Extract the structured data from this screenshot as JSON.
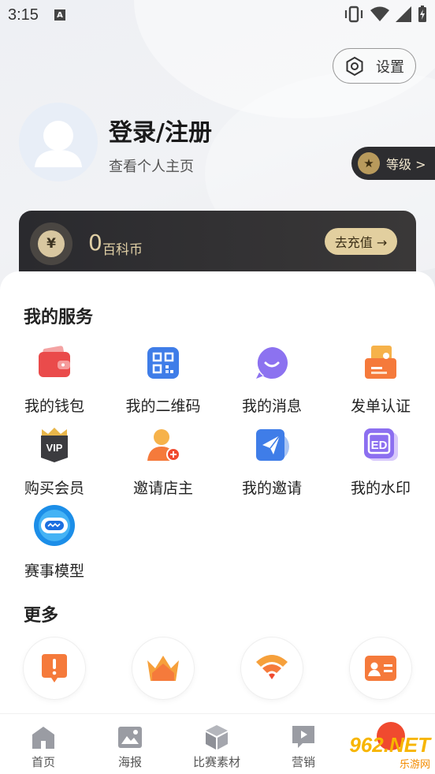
{
  "status_bar": {
    "time": "3:15",
    "notification_icon": "A"
  },
  "header": {
    "settings_label": "设置",
    "login_title": "登录/注册",
    "login_subtitle": "查看个人主页",
    "level_label": "等级 >"
  },
  "coin_card": {
    "value": "0",
    "unit": "百科币",
    "recharge_label": "去充值 →"
  },
  "services": {
    "title": "我的服务",
    "items": [
      {
        "label": "我的钱包",
        "icon": "wallet-icon"
      },
      {
        "label": "我的二维码",
        "icon": "qrcode-icon"
      },
      {
        "label": "我的消息",
        "icon": "message-icon"
      },
      {
        "label": "发单认证",
        "icon": "certificate-icon"
      },
      {
        "label": "购买会员",
        "icon": "vip-icon"
      },
      {
        "label": "邀请店主",
        "icon": "invite-owner-icon"
      },
      {
        "label": "我的邀请",
        "icon": "paper-plane-icon"
      },
      {
        "label": "我的水印",
        "icon": "watermark-icon"
      },
      {
        "label": "赛事模型",
        "icon": "robot-icon"
      }
    ]
  },
  "more": {
    "title": "更多",
    "items": [
      {
        "icon": "alert-icon"
      },
      {
        "icon": "crown-icon"
      },
      {
        "icon": "wifi-icon"
      },
      {
        "icon": "id-card-icon"
      }
    ]
  },
  "tabbar": {
    "items": [
      {
        "label": "首页",
        "icon": "home-icon"
      },
      {
        "label": "海报",
        "icon": "image-icon"
      },
      {
        "label": "比赛素材",
        "icon": "cube-icon"
      },
      {
        "label": "营销",
        "icon": "play-icon"
      }
    ]
  },
  "watermark": {
    "site": "962.NET",
    "name": "乐游网"
  },
  "colors": {
    "accent_gold": "#e2cf9f",
    "card_dark": "#2a2a2e",
    "orange": "#f57a3b",
    "blue": "#4a7fe6"
  }
}
